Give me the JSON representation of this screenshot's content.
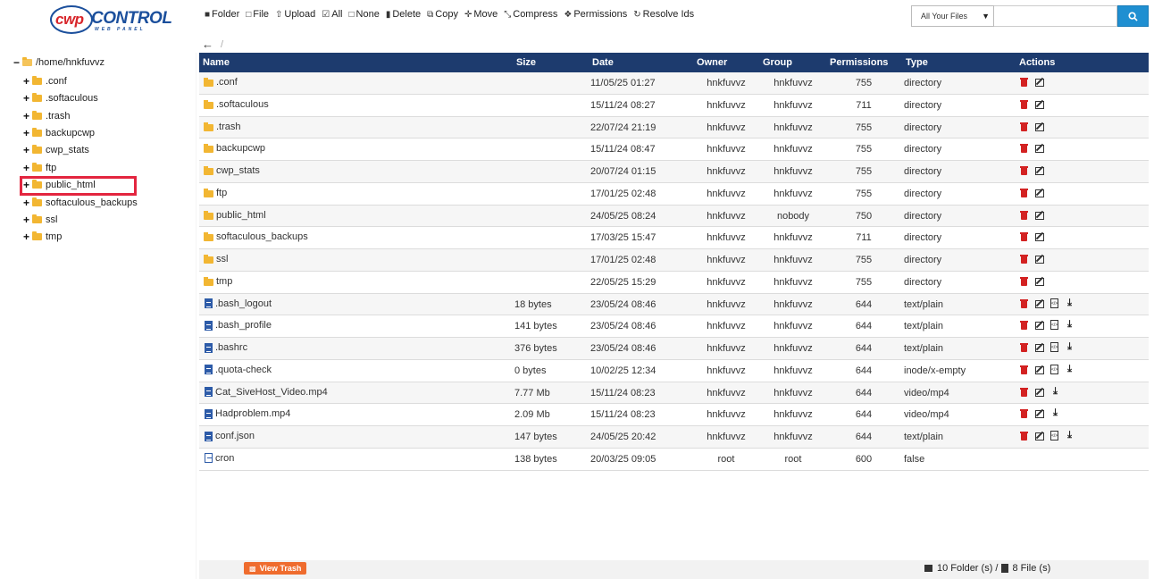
{
  "toolbar": {
    "buttons": [
      {
        "label": "Folder",
        "icon": "folder-icon"
      },
      {
        "label": "File",
        "icon": "file-icon"
      },
      {
        "label": "Upload",
        "icon": "upload-icon"
      },
      {
        "label": "All",
        "icon": "check-square-icon"
      },
      {
        "label": "None",
        "icon": "square-icon"
      },
      {
        "label": "Delete",
        "icon": "trash-icon"
      },
      {
        "label": "Copy",
        "icon": "copy-icon"
      },
      {
        "label": "Move",
        "icon": "move-icon"
      },
      {
        "label": "Compress",
        "icon": "compress-icon"
      },
      {
        "label": "Permissions",
        "icon": "users-icon"
      },
      {
        "label": "Resolve Ids",
        "icon": "refresh-icon"
      }
    ]
  },
  "search": {
    "scope": "All Your Files",
    "placeholder": ""
  },
  "path": {
    "current": "/"
  },
  "tree": {
    "root": "/home/hnkfuvvz",
    "items": [
      ".conf",
      ".softaculous",
      ".trash",
      "backupcwp",
      "cwp_stats",
      "ftp",
      "public_html",
      "softaculous_backups",
      "ssl",
      "tmp"
    ],
    "highlighted": "public_html"
  },
  "table": {
    "headers": {
      "name": "Name",
      "size": "Size",
      "date": "Date",
      "owner": "Owner",
      "group": "Group",
      "permissions": "Permissions",
      "type": "Type",
      "actions": "Actions"
    },
    "rows": [
      {
        "name": ".conf",
        "size": "",
        "date": "11/05/25 01:27",
        "owner": "hnkfuvvz",
        "group": "hnkfuvvz",
        "perm": "755",
        "type": "directory",
        "kind": "folder"
      },
      {
        "name": ".softaculous",
        "size": "",
        "date": "15/11/24 08:27",
        "owner": "hnkfuvvz",
        "group": "hnkfuvvz",
        "perm": "711",
        "type": "directory",
        "kind": "folder"
      },
      {
        "name": ".trash",
        "size": "",
        "date": "22/07/24 21:19",
        "owner": "hnkfuvvz",
        "group": "hnkfuvvz",
        "perm": "755",
        "type": "directory",
        "kind": "folder"
      },
      {
        "name": "backupcwp",
        "size": "",
        "date": "15/11/24 08:47",
        "owner": "hnkfuvvz",
        "group": "hnkfuvvz",
        "perm": "755",
        "type": "directory",
        "kind": "folder"
      },
      {
        "name": "cwp_stats",
        "size": "",
        "date": "20/07/24 01:15",
        "owner": "hnkfuvvz",
        "group": "hnkfuvvz",
        "perm": "755",
        "type": "directory",
        "kind": "folder"
      },
      {
        "name": "ftp",
        "size": "",
        "date": "17/01/25 02:48",
        "owner": "hnkfuvvz",
        "group": "hnkfuvvz",
        "perm": "755",
        "type": "directory",
        "kind": "folder"
      },
      {
        "name": "public_html",
        "size": "",
        "date": "24/05/25 08:24",
        "owner": "hnkfuvvz",
        "group": "nobody",
        "perm": "750",
        "type": "directory",
        "kind": "folder"
      },
      {
        "name": "softaculous_backups",
        "size": "",
        "date": "17/03/25 15:47",
        "owner": "hnkfuvvz",
        "group": "hnkfuvvz",
        "perm": "711",
        "type": "directory",
        "kind": "folder"
      },
      {
        "name": "ssl",
        "size": "",
        "date": "17/01/25 02:48",
        "owner": "hnkfuvvz",
        "group": "hnkfuvvz",
        "perm": "755",
        "type": "directory",
        "kind": "folder"
      },
      {
        "name": "tmp",
        "size": "",
        "date": "22/05/25 15:29",
        "owner": "hnkfuvvz",
        "group": "hnkfuvvz",
        "perm": "755",
        "type": "directory",
        "kind": "folder"
      },
      {
        "name": ".bash_logout",
        "size": "18 bytes",
        "date": "23/05/24 08:46",
        "owner": "hnkfuvvz",
        "group": "hnkfuvvz",
        "perm": "644",
        "type": "text/plain",
        "kind": "text"
      },
      {
        "name": ".bash_profile",
        "size": "141 bytes",
        "date": "23/05/24 08:46",
        "owner": "hnkfuvvz",
        "group": "hnkfuvvz",
        "perm": "644",
        "type": "text/plain",
        "kind": "text"
      },
      {
        "name": ".bashrc",
        "size": "376 bytes",
        "date": "23/05/24 08:46",
        "owner": "hnkfuvvz",
        "group": "hnkfuvvz",
        "perm": "644",
        "type": "text/plain",
        "kind": "text"
      },
      {
        "name": ".quota-check",
        "size": "0 bytes",
        "date": "10/02/25 12:34",
        "owner": "hnkfuvvz",
        "group": "hnkfuvvz",
        "perm": "644",
        "type": "inode/x-empty",
        "kind": "text"
      },
      {
        "name": "Cat_SiveHost_Video.mp4",
        "size": "7.77 Mb",
        "date": "15/11/24 08:23",
        "owner": "hnkfuvvz",
        "group": "hnkfuvvz",
        "perm": "644",
        "type": "video/mp4",
        "kind": "media"
      },
      {
        "name": "Hadproblem.mp4",
        "size": "2.09 Mb",
        "date": "15/11/24 08:23",
        "owner": "hnkfuvvz",
        "group": "hnkfuvvz",
        "perm": "644",
        "type": "video/mp4",
        "kind": "media"
      },
      {
        "name": "conf.json",
        "size": "147 bytes",
        "date": "24/05/25 20:42",
        "owner": "hnkfuvvz",
        "group": "hnkfuvvz",
        "perm": "644",
        "type": "text/plain",
        "kind": "text"
      },
      {
        "name": "cron",
        "size": "138 bytes",
        "date": "20/03/25 09:05",
        "owner": "root",
        "group": "root",
        "perm": "600",
        "type": "false",
        "kind": "root"
      }
    ]
  },
  "footer": {
    "view_trash": "View Trash",
    "folders": "10 Folder (s) /",
    "files": "8 File (s)"
  },
  "colors": {
    "header_bg": "#1d3b6e",
    "search_button": "#1f8fd1",
    "trash_button": "#ef6c2e",
    "highlight": "#e3253f"
  }
}
